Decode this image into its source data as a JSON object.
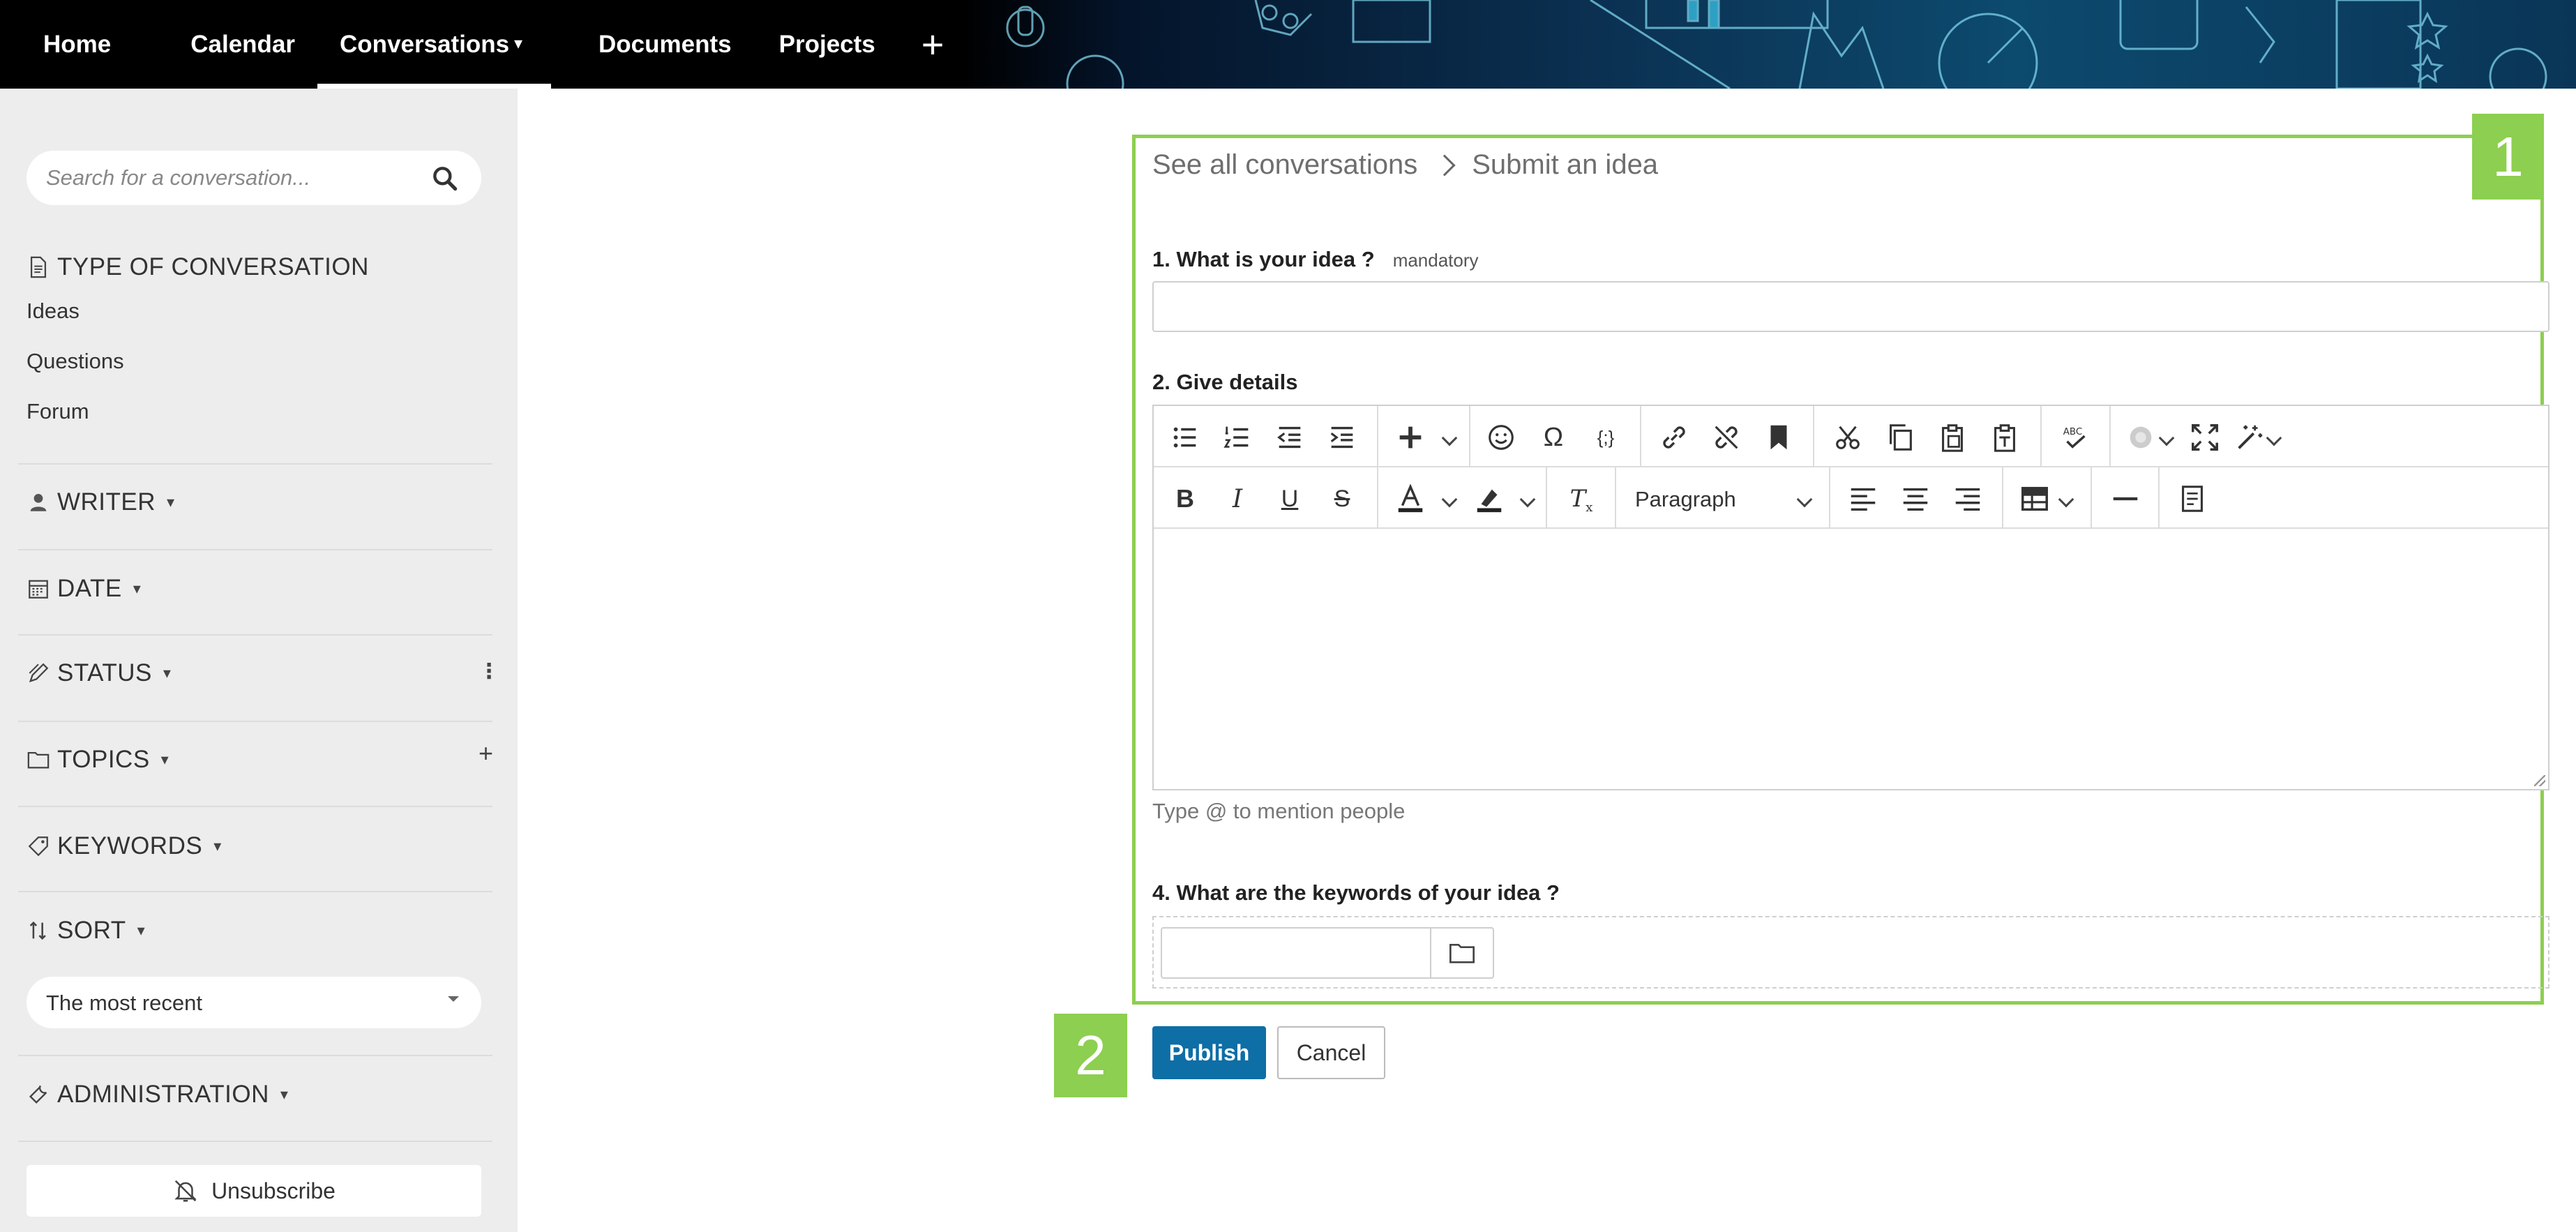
{
  "nav": {
    "items": [
      {
        "label": "Home"
      },
      {
        "label": "Calendar"
      },
      {
        "label": "Conversations",
        "active": true
      },
      {
        "label": "Documents"
      },
      {
        "label": "Projects"
      }
    ],
    "plus": "+"
  },
  "sidebar": {
    "search_placeholder": "Search for a conversation...",
    "type_title": "TYPE OF CONVERSATION",
    "type_items": [
      "Ideas",
      "Questions",
      "Forum"
    ],
    "writer": "WRITER",
    "date": "DATE",
    "status": "STATUS",
    "topics": "TOPICS",
    "keywords": "KEYWORDS",
    "sort": "SORT",
    "sort_value": "The most recent",
    "administration": "ADMINISTRATION",
    "unsubscribe": "Unsubscribe"
  },
  "form": {
    "breadcrumb_parent": "See all conversations",
    "breadcrumb_current": "Submit an idea",
    "q1_label": "1. What is your idea ?",
    "q1_mandatory": "mandatory",
    "q2_label": "2. Give details",
    "paragraph_select": "Paragraph",
    "mention_hint": "Type @ to mention people",
    "q4_label": "4. What are the keywords of your idea ?",
    "publish": "Publish",
    "cancel": "Cancel"
  },
  "badges": {
    "one": "1",
    "two": "2"
  },
  "colors": {
    "accent_green": "#8dcf50",
    "publish_blue": "#0e6ea6",
    "sidebar_bg": "#ededed"
  }
}
